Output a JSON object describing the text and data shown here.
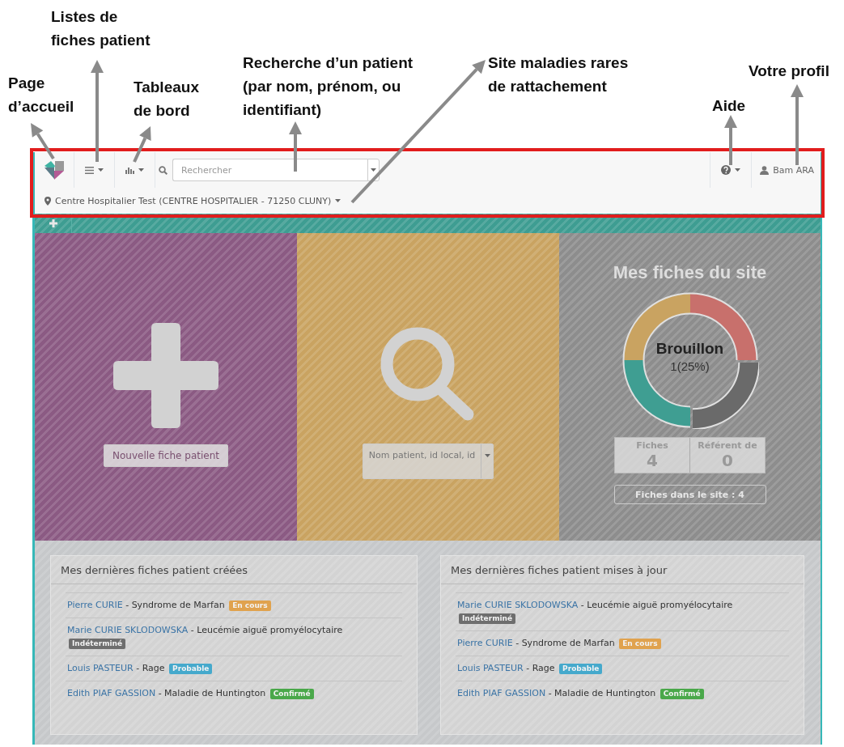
{
  "annotations": [
    {
      "label": "Listes de\nfiches patient"
    },
    {
      "label": "Page\nd’accueil"
    },
    {
      "label": "Tableaux\nde bord"
    },
    {
      "label": "Recherche d’un patient\n(par nom, prénom, ou\nidentifiant)"
    },
    {
      "label": "Site maladies rares\nde rattachement"
    },
    {
      "label": "Votre profil"
    },
    {
      "label": "Aide"
    }
  ],
  "navbar": {
    "search": {
      "placeholder": "Rechercher"
    },
    "user": "Bam ARA",
    "site": "Centre Hospitalier Test (CENTRE HOSPITALIER - 71250 CLUNY)"
  },
  "tiles": {
    "new_patient": {
      "button": "Nouvelle fiche patient"
    },
    "search": {
      "placeholder": "Nom patient, id local, id"
    },
    "site": {
      "title": "Mes fiches du site",
      "donut_label": "Brouillon",
      "donut_value": "1(25%)",
      "stats": [
        {
          "label": "Fiches",
          "value": "4"
        },
        {
          "label": "Référent de",
          "value": "0"
        }
      ],
      "button": "Fiches dans le site : 4"
    }
  },
  "panels": [
    {
      "title": "Mes dernières fiches patient créées",
      "items": [
        {
          "name": "Pierre CURIE",
          "diagnosis": "- Syndrome de Marfan",
          "status": "En cours",
          "color": "#e0a24e"
        },
        {
          "name": "Marie CURIE SKLODOWSKA",
          "diagnosis": "- Leucémie aiguë promyélocytaire",
          "status": "Indéterminé",
          "color": "#6e6e6e"
        },
        {
          "name": "Louis PASTEUR",
          "diagnosis": "- Rage",
          "status": "Probable",
          "color": "#45a9cc"
        },
        {
          "name": "Edith PIAF GASSION",
          "diagnosis": "- Maladie de Huntington",
          "status": "Confirmé",
          "color": "#4aa84a"
        }
      ]
    },
    {
      "title": "Mes dernières fiches patient mises à jour",
      "items": [
        {
          "name": "Marie CURIE SKLODOWSKA",
          "diagnosis": "- Leucémie aiguë promyélocytaire",
          "status": "Indéterminé",
          "color": "#6e6e6e"
        },
        {
          "name": "Pierre CURIE",
          "diagnosis": "- Syndrome de Marfan",
          "status": "En cours",
          "color": "#e0a24e"
        },
        {
          "name": "Louis PASTEUR",
          "diagnosis": "- Rage",
          "status": "Probable",
          "color": "#45a9cc"
        },
        {
          "name": "Edith PIAF GASSION",
          "diagnosis": "- Maladie de Huntington",
          "status": "Confirmé",
          "color": "#4aa84a"
        }
      ]
    }
  ]
}
